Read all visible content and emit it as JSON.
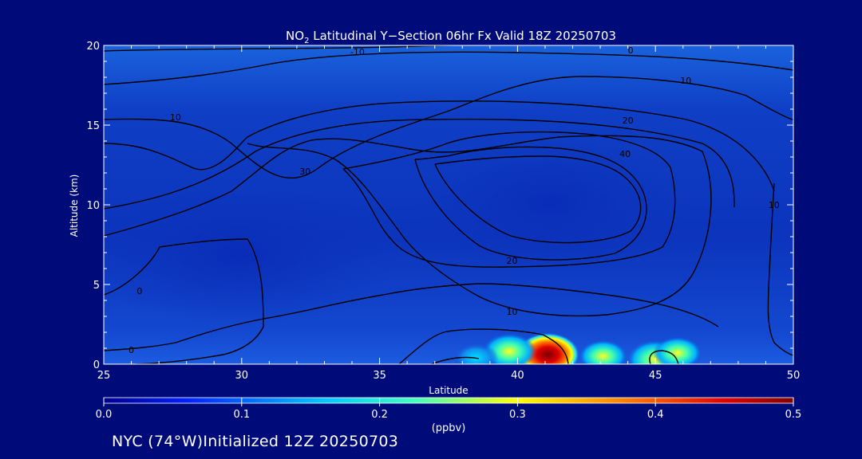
{
  "title_main": "NO",
  "title_sub": "2",
  "title_rest": " Latitudinal Y−Section 06hr  Fx Valid 18Z 20250703",
  "footer": "NYC (74°W)Initialized 12Z 20250703",
  "colors": {
    "background": "#000b7a",
    "field_base": "#1044c8",
    "contour": "#000000"
  },
  "chart_data": {
    "type": "heatmap",
    "title": "NO2 Latitudinal Y-Section 06hr  Fx Valid 18Z 20250703",
    "xlabel": "Latitude",
    "ylabel": "Altitude (km)",
    "xlim": [
      25,
      50
    ],
    "ylim": [
      0,
      20
    ],
    "xticks": [
      25,
      30,
      35,
      40,
      45,
      50
    ],
    "yticks": [
      0,
      5,
      10,
      15,
      20
    ],
    "colorbar": {
      "label": "(ppbv)",
      "range": [
        0.0,
        0.5
      ],
      "ticks": [
        "0.0",
        "0.1",
        "0.2",
        "0.3",
        "0.4",
        "0.5"
      ]
    },
    "contour_labels": [
      {
        "text": "-10",
        "lat": 34.2,
        "alt": 19.6
      },
      {
        "text": "0",
        "lat": 44.1,
        "alt": 19.7
      },
      {
        "text": "10",
        "lat": 46.1,
        "alt": 17.8
      },
      {
        "text": "10",
        "lat": 27.6,
        "alt": 15.5
      },
      {
        "text": "20",
        "lat": 44.0,
        "alt": 15.3
      },
      {
        "text": "30",
        "lat": 32.3,
        "alt": 12.1
      },
      {
        "text": "40",
        "lat": 43.9,
        "alt": 13.2
      },
      {
        "text": "10",
        "lat": 49.3,
        "alt": 10.0
      },
      {
        "text": "20",
        "lat": 39.8,
        "alt": 6.5
      },
      {
        "text": "10",
        "lat": 39.8,
        "alt": 3.3
      },
      {
        "text": "0",
        "lat": 26.3,
        "alt": 4.6
      },
      {
        "text": "0",
        "lat": 26.0,
        "alt": 0.9
      }
    ],
    "hotspots": [
      {
        "lat": 41.1,
        "alt": 0.7,
        "value": 0.45
      },
      {
        "lat": 45.0,
        "alt": 0.4,
        "value": 0.35
      },
      {
        "lat": 39.7,
        "alt": 0.9,
        "value": 0.3
      },
      {
        "lat": 43.1,
        "alt": 0.6,
        "value": 0.22
      },
      {
        "lat": 45.8,
        "alt": 0.8,
        "value": 0.22
      },
      {
        "lat": 38.5,
        "alt": 0.5,
        "value": 0.15
      }
    ]
  }
}
